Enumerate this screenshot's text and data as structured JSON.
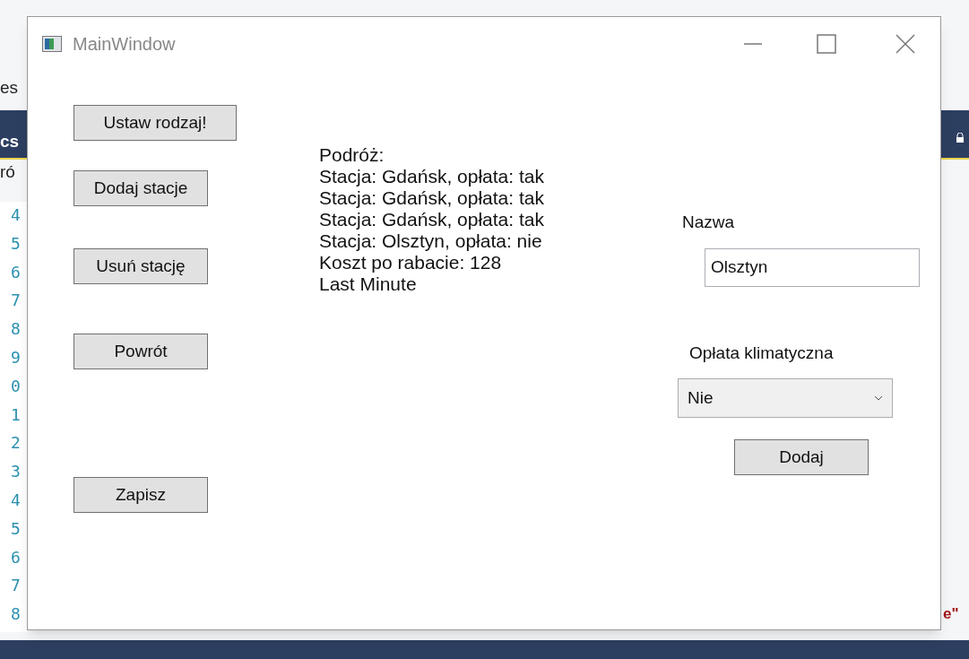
{
  "background": {
    "left_fragments": [
      "es",
      "cs",
      "ró"
    ],
    "line_numbers": [
      "4",
      "5",
      "6",
      "7",
      "8",
      "9",
      "0",
      "1",
      "2",
      "3",
      "4",
      "5",
      "6",
      "7",
      "8"
    ],
    "right_fragment": "e\""
  },
  "window": {
    "title": "MainWindow"
  },
  "left_buttons": [
    "Ustaw rodzaj!",
    "Dodaj stacje",
    "Usuń stację",
    "Powrót",
    "Zapisz"
  ],
  "trip_lines": [
    "Podróż:",
    "Stacja: Gdańsk, opłata: tak",
    "Stacja: Gdańsk, opłata: tak",
    "Stacja: Gdańsk, opłata: tak",
    "Stacja: Olsztyn, opłata: nie",
    "Koszt po rabacie: 128",
    "Last Minute"
  ],
  "name_label": "Nazwa",
  "name_field": {
    "value": "Olsztyn"
  },
  "fee_label": "Opłata klimatyczna",
  "fee_combo": {
    "value": "Nie"
  },
  "add_button": "Dodaj"
}
